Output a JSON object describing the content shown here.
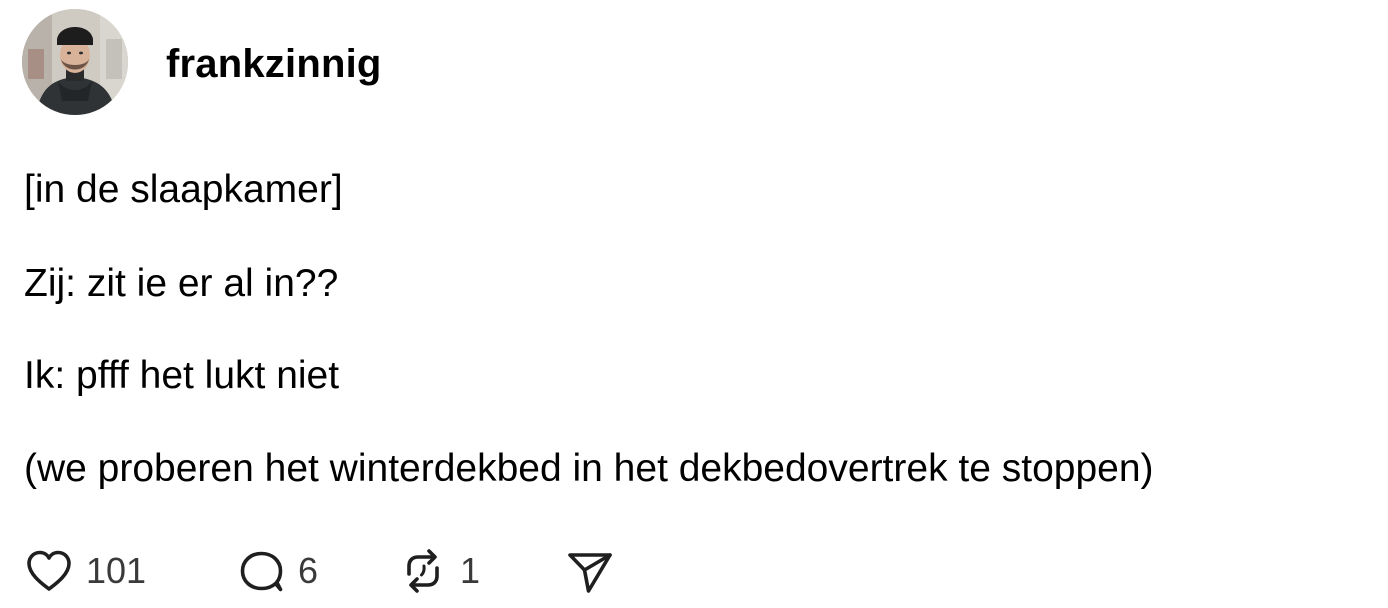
{
  "post": {
    "author": {
      "username": "frankzinnig",
      "avatar_icon": "avatar-photo"
    },
    "lines": [
      "[in de slaapkamer]",
      "Zij: zit ie er al in??",
      "Ik: pfff het lukt niet",
      "(we proberen het winterdekbed in het dekbedovertrek te stoppen)"
    ],
    "actions": {
      "like": {
        "icon": "heart-icon",
        "count": "101"
      },
      "reply": {
        "icon": "speech-bubble-icon",
        "count": "6"
      },
      "repost": {
        "icon": "repost-icon",
        "count": "1"
      },
      "share": {
        "icon": "send-icon"
      }
    }
  },
  "colors": {
    "text": "#000000",
    "count_text": "#3a3a3a",
    "icon_stroke": "#1f1f1f",
    "background": "#ffffff"
  }
}
